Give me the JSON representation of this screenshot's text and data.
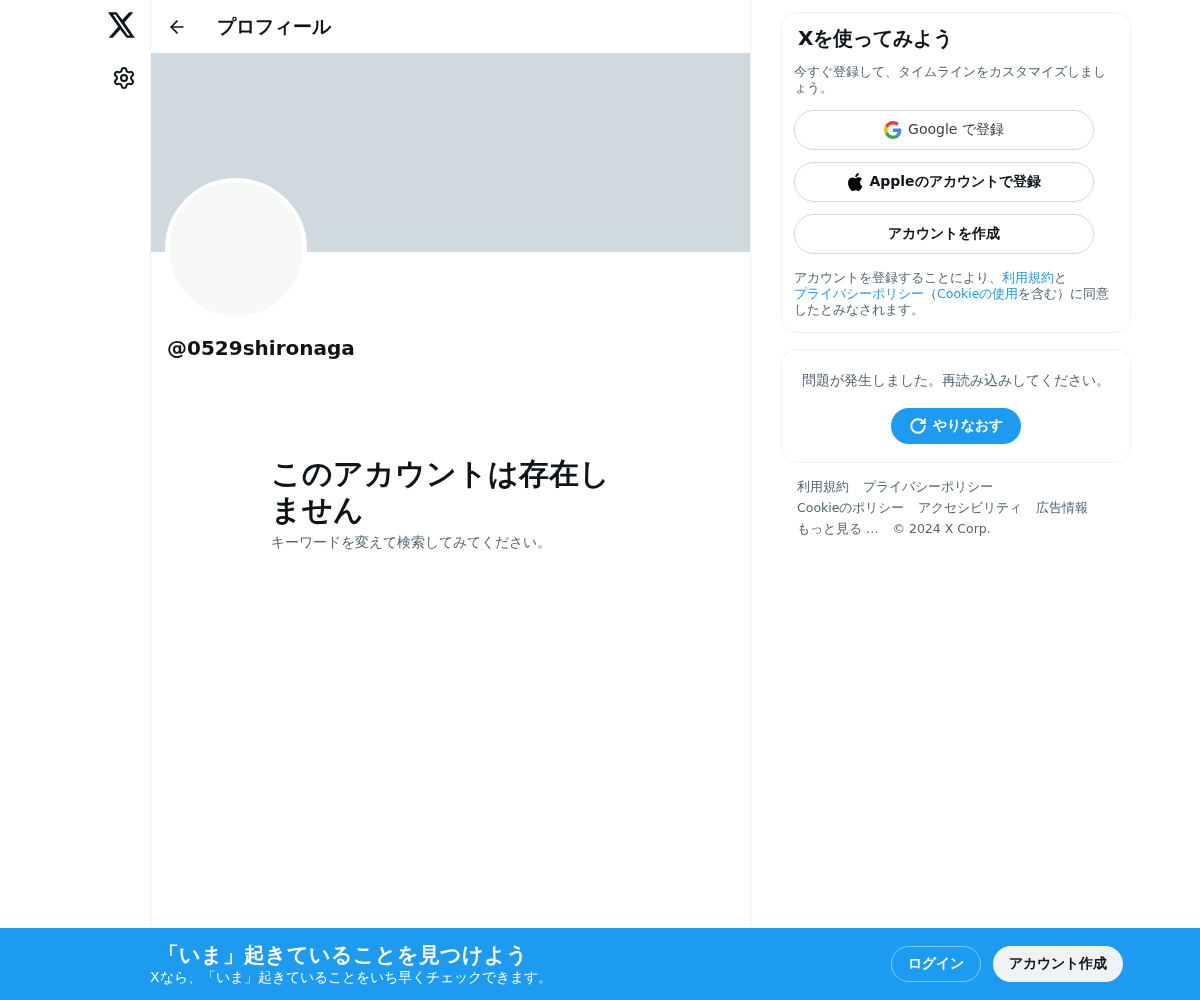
{
  "header": {
    "title": "プロフィール"
  },
  "profile": {
    "handle": "@0529shironaga"
  },
  "empty_state": {
    "title": "このアカウントは存在しません",
    "subtitle": "キーワードを変えて検索してみてください。"
  },
  "signup": {
    "title": "Xを使ってみよう",
    "subtitle": "今すぐ登録して、タイムラインをカスタマイズしましょう。",
    "buttons": [
      {
        "kind": "google",
        "label": "Google で登録"
      },
      {
        "kind": "apple",
        "label": "Appleのアカウントで登録"
      },
      {
        "kind": "plain",
        "label": "アカウントを作成"
      }
    ],
    "legal": [
      {
        "text": "アカウントを登録することにより、",
        "link": false
      },
      {
        "text": "利用規約",
        "link": true
      },
      {
        "text": "と",
        "link": false
      },
      {
        "text": "プライバシーポリシー",
        "link": true
      },
      {
        "text": "（",
        "link": false
      },
      {
        "text": "Cookieの使用",
        "link": true
      },
      {
        "text": "を含む）に同意したとみなされます。",
        "link": false
      }
    ]
  },
  "error_card": {
    "message": "問題が発生しました。再読み込みしてください。",
    "retry": "やりなおす"
  },
  "footer_links": [
    "利用規約",
    "プライバシーポリシー",
    "Cookieのポリシー",
    "アクセシビリティ",
    "広告情報",
    "もっと見る …"
  ],
  "copyright": "© 2024 X Corp.",
  "banner": {
    "title": "「いま」起きていることを見つけよう",
    "subtitle": "Xなら、「いま」起きていることをいち早くチェックできます。",
    "login": "ログイン",
    "signup": "アカウント作成"
  }
}
